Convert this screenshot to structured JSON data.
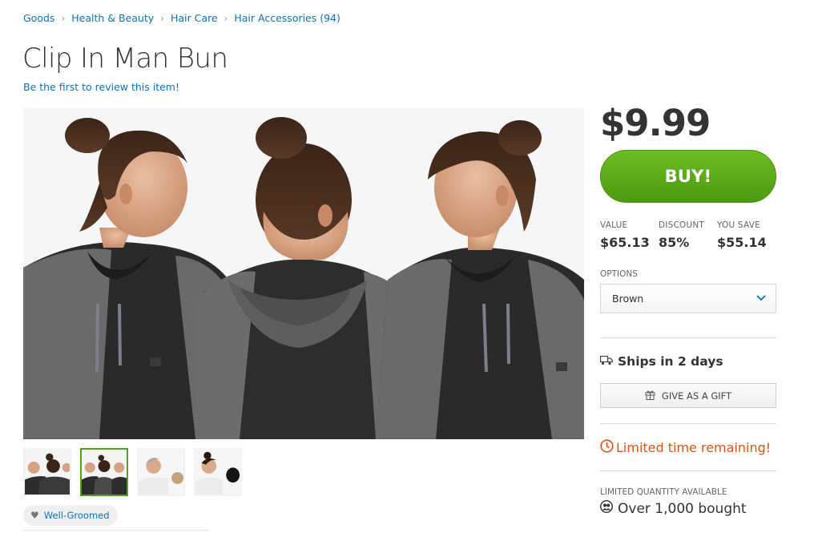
{
  "breadcrumb": [
    "Goods",
    "Health & Beauty",
    "Hair Care",
    "Hair Accessories (94)"
  ],
  "product": {
    "title": "Clip In Man Bun",
    "review_link": "Be the first to review this item!"
  },
  "purchase": {
    "price": "$9.99",
    "buy_label": "BUY!",
    "stats": [
      {
        "label": "VALUE",
        "value": "$65.13"
      },
      {
        "label": "DISCOUNT",
        "value": "85%"
      },
      {
        "label": "YOU SAVE",
        "value": "$55.14"
      }
    ],
    "options_label": "OPTIONS",
    "selected_option": "Brown",
    "ships": "Ships in 2 days",
    "gift_label": "GIVE AS A GIFT",
    "limited": "Limited time remaining!",
    "quantity_label": "LIMITED QUANTITY AVAILABLE",
    "bought": "Over 1,000 bought"
  },
  "tag": {
    "label": "Well-Groomed"
  },
  "colors": {
    "link": "#0b73c4",
    "buy_green": "#53a318",
    "limited_orange": "#e35414"
  },
  "icons": [
    "chevron-right-icon",
    "chevron-down-icon",
    "truck-icon",
    "gift-icon",
    "clock-icon",
    "people-icon",
    "heart-icon"
  ],
  "thumbnails": {
    "count": 4,
    "active_index": 1
  }
}
